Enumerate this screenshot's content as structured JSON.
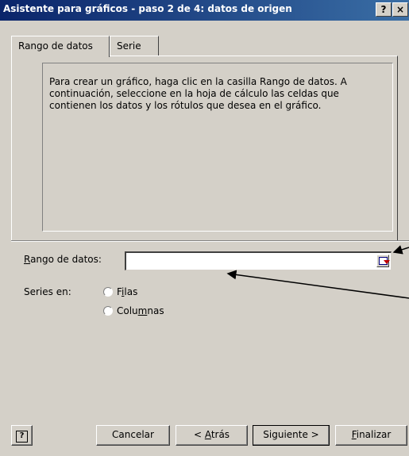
{
  "window": {
    "title": "Asistente para gráficos - paso 2 de 4: datos de origen",
    "help_btn": "?",
    "close_btn": "×"
  },
  "tabs": [
    {
      "label": "Rango de datos",
      "active": true
    },
    {
      "label": "Serie",
      "active": false
    }
  ],
  "instruction": "Para crear un gráfico, haga clic en la casilla Rango de datos. A continuación, seleccione en la hoja de cálculo las celdas que contienen los datos y los rótulos que desea en el gráfico.",
  "range": {
    "label_mnemonic": "R",
    "label_rest": "ango de datos:",
    "value": ""
  },
  "series_in": {
    "label": "Series en:",
    "rows_pre": "F",
    "rows_mn": "i",
    "rows_post": "las",
    "cols_pre": "Colu",
    "cols_mn": "m",
    "cols_post": "nas"
  },
  "buttons": {
    "help": "?",
    "cancel": "Cancelar",
    "back_pre": "< ",
    "back_mn": "A",
    "back_post": "trás",
    "next": "Siguiente >",
    "finish_mn": "F",
    "finish_post": "inalizar"
  }
}
